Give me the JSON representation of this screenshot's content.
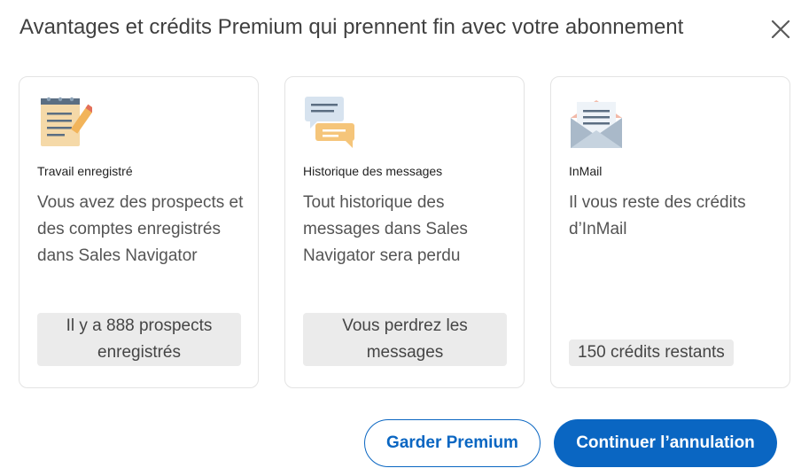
{
  "dialog": {
    "title": "Avantages et crédits Premium qui prennent fin avec votre abonnement",
    "close_icon": "close-icon"
  },
  "cards": [
    {
      "icon": "notepad-pencil-icon",
      "title": "Travail enregistré",
      "description": "Vous avez des prospects et des comptes enregistrés dans Sales Navigator",
      "badge": "Il y a 888 prospects enregistrés"
    },
    {
      "icon": "chat-bubbles-icon",
      "title": "Historique des messages",
      "description": "Tout historique des messages dans Sales Navigator sera perdu",
      "badge": "Vous perdrez les messages"
    },
    {
      "icon": "envelope-letter-icon",
      "title": "InMail",
      "description": "Il vous reste des crédits d’InMail",
      "badge": "150 crédits restants"
    }
  ],
  "buttons": {
    "keep_label": "Garder Premium",
    "continue_label": "Continuer l’annulation"
  },
  "colors": {
    "accent": "#0a66c2",
    "badge_bg": "#ebebeb",
    "card_border": "#e3e3e3"
  }
}
